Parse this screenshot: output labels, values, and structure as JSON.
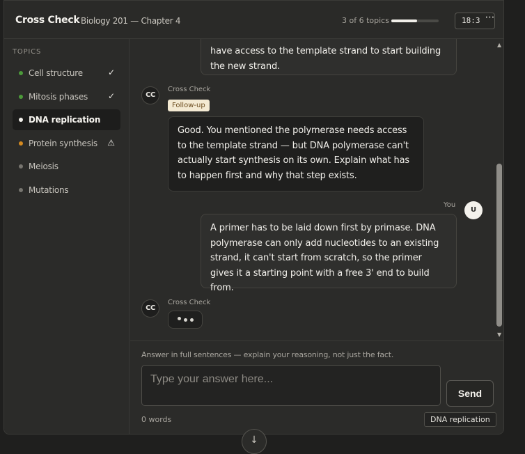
{
  "header": {
    "app_title": "Cross Check",
    "subtitle": "Biology 201 — Chapter 4",
    "progress_text": "3 of 6 topics",
    "progress_fraction": 0.55,
    "timer": "18:3",
    "more_label": "⋯"
  },
  "sidebar": {
    "heading": "TOPICS",
    "items": [
      {
        "label": "Cell structure",
        "status": "done",
        "dot_color": "#4c9a3a",
        "mark": "✓"
      },
      {
        "label": "Mitosis phases",
        "status": "done",
        "dot_color": "#4c9a3a",
        "mark": "✓"
      },
      {
        "label": "DNA replication",
        "status": "active",
        "dot_color": "#f3f1ec",
        "mark": ""
      },
      {
        "label": "Protein synthesis",
        "status": "flagged",
        "dot_color": "#d58a1f",
        "mark": "⚠"
      },
      {
        "label": "Meiosis",
        "status": "pending",
        "dot_color": "#77756f",
        "mark": ""
      },
      {
        "label": "Mutations",
        "status": "pending",
        "dot_color": "#77756f",
        "mark": ""
      }
    ]
  },
  "messages": {
    "partial_user_text": "have access to the template strand to start building the new strand.",
    "ai_avatar": "CC",
    "ai_sender": "Cross Check",
    "followup_badge": "Follow-up",
    "ai_text": "Good. You mentioned the polymerase needs access to the template strand — but DNA polymerase can't actually start synthesis on its own. Explain what has to happen first and why that step exists.",
    "user_sender": "You",
    "user_avatar": "U",
    "user_text": "A primer has to be laid down first by primase. DNA polymerase can only add nucleotides to an existing strand, it can't start from scratch, so the primer gives it a starting point with a free 3' end to build from."
  },
  "composer": {
    "hint": "Answer in full sentences — explain your reasoning, not just the fact.",
    "placeholder": "Type your answer here...",
    "send_label": "Send",
    "word_count": "0 words",
    "topic_tag": "DNA replication"
  }
}
